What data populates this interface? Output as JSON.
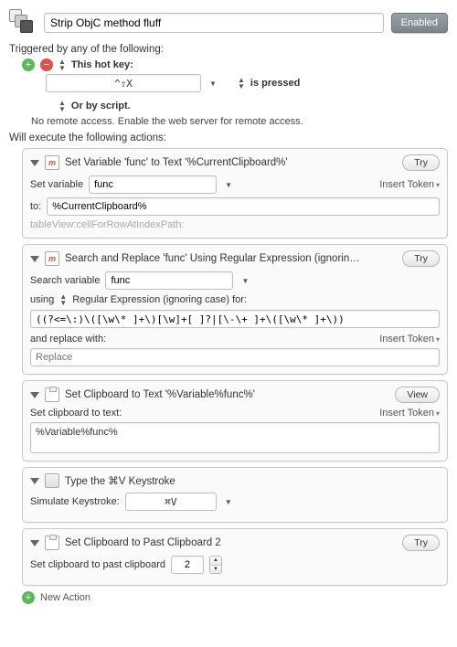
{
  "header": {
    "title_value": "Strip ObjC method fluff",
    "enabled_label": "Enabled"
  },
  "triggers": {
    "heading": "Triggered by any of the following:",
    "hotkey_label": "This hot key:",
    "hotkey_value": "^⇧X",
    "state_label": "is pressed",
    "script_label": "Or by script.",
    "remote_text": "No remote access.  Enable the web server for remote access."
  },
  "actions_heading": "Will execute the following actions:",
  "action1": {
    "title": "Set Variable 'func' to Text '%CurrentClipboard%'",
    "try_label": "Try",
    "set_variable_label": "Set variable",
    "variable_value": "func",
    "insert_token": "Insert Token",
    "to_label": "to:",
    "to_value": "%CurrentClipboard%",
    "result": "tableView:cellForRowAtIndexPath:"
  },
  "action2": {
    "title": "Search and Replace 'func' Using Regular Expression (ignorin…",
    "try_label": "Try",
    "search_label": "Search variable",
    "search_value": "func",
    "using_label": "using",
    "regex_label": "Regular Expression (ignoring case) for:",
    "regex_value": "((?<=\\:)\\([\\w\\* ]+\\)[\\w]+[ ]?|[\\-\\+ ]+\\([\\w\\* ]+\\))",
    "replace_label": "and replace with:",
    "insert_token": "Insert Token",
    "replace_placeholder": "Replace"
  },
  "action3": {
    "title": "Set Clipboard to Text '%Variable%func%'",
    "view_label": "View",
    "set_label": "Set clipboard to text:",
    "insert_token": "Insert Token",
    "value": "%Variable%func%"
  },
  "action4": {
    "title": "Type the ⌘V Keystroke",
    "simulate_label": "Simulate Keystroke:",
    "key_value": "⌘V"
  },
  "action5": {
    "title": "Set Clipboard to Past Clipboard 2",
    "try_label": "Try",
    "label": "Set clipboard to past clipboard",
    "value": "2"
  },
  "footer": {
    "new_action": "New Action"
  }
}
